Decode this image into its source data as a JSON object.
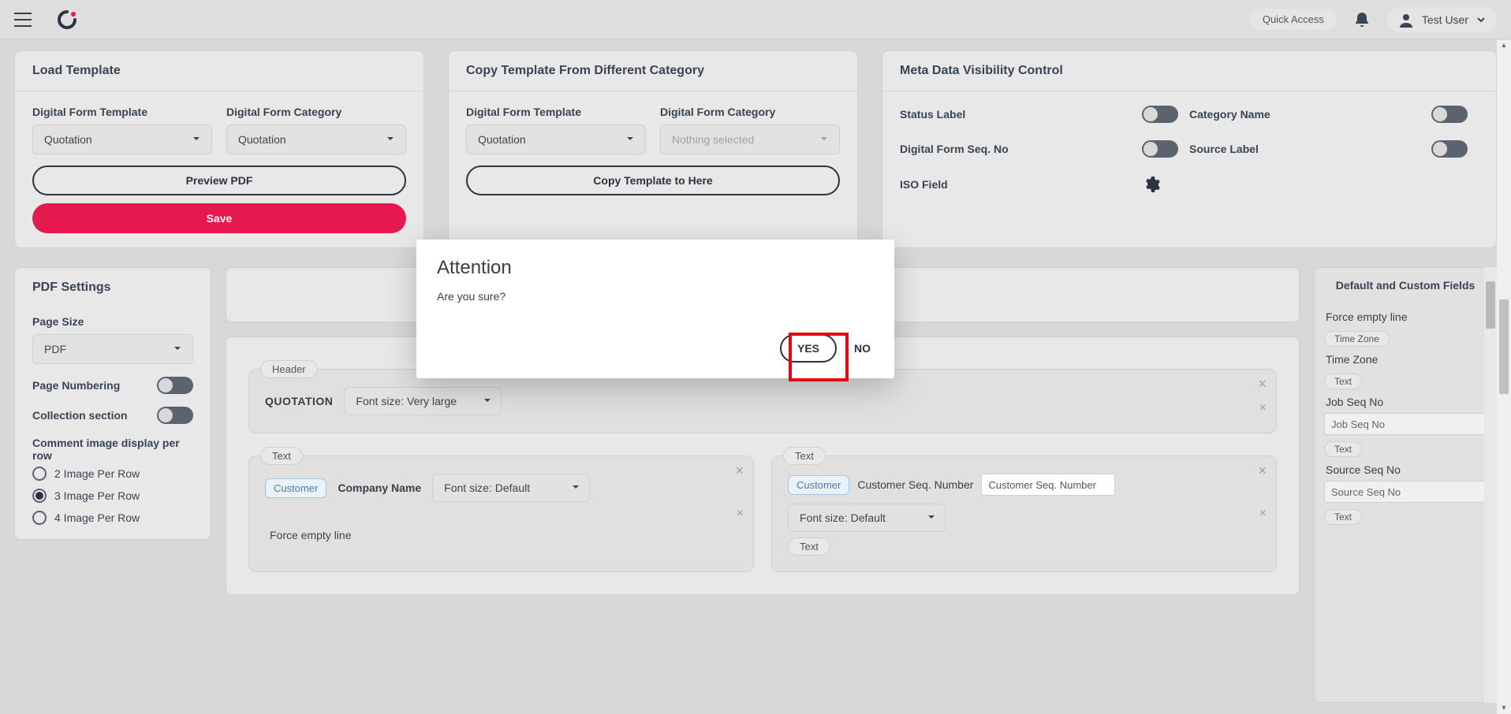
{
  "topbar": {
    "quick_access": "Quick Access",
    "user_name": "Test User"
  },
  "cards": {
    "load": {
      "title": "Load Template",
      "template_label": "Digital Form Template",
      "template_value": "Quotation",
      "category_label": "Digital Form Category",
      "category_value": "Quotation",
      "preview_btn": "Preview PDF",
      "save_btn": "Save"
    },
    "copy": {
      "title": "Copy Template From Different Category",
      "template_label": "Digital Form Template",
      "template_value": "Quotation",
      "category_label": "Digital Form Category",
      "category_value": "Nothing selected",
      "copy_btn": "Copy Template to Here"
    },
    "meta": {
      "title": "Meta Data Visibility Control",
      "status_label": "Status Label",
      "category_name": "Category Name",
      "seq_no": "Digital Form Seq. No",
      "source_label": "Source Label",
      "iso_field": "ISO Field"
    }
  },
  "pdf_settings": {
    "title": "PDF Settings",
    "page_size_label": "Page Size",
    "page_size_value": "PDF",
    "page_numbering": "Page Numbering",
    "collection_section": "Collection section",
    "comment_heading": "Comment image display per row",
    "radios": [
      "2 Image Per Row",
      "3 Image Per Row",
      "4 Image Per Row"
    ]
  },
  "designer": {
    "header_tag": "Header",
    "header_title": "QUOTATION",
    "header_font": "Font size: Very large",
    "text_tag": "Text",
    "customer_chip": "Customer",
    "company_name_label": "Company Name",
    "default_font": "Font size: Default",
    "customer_seq_label": "Customer Seq. Number",
    "customer_seq_value": "Customer Seq. Number",
    "force_empty": "Force empty line"
  },
  "fields_panel": {
    "title": "Default and Custom Fields",
    "force_empty": "Force empty line",
    "tz_tag": "Time Zone",
    "tz_label": "Time Zone",
    "text_tag": "Text",
    "job_seq_label": "Job Seq No",
    "job_seq_value": "Job Seq No",
    "source_seq_label": "Source Seq No",
    "source_seq_value": "Source Seq No"
  },
  "modal": {
    "title": "Attention",
    "body": "Are you sure?",
    "yes": "YES",
    "no": "NO"
  }
}
